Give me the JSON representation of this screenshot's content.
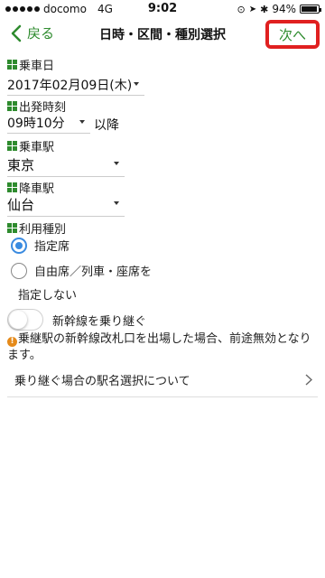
{
  "status_bar": {
    "carrier": "docomo",
    "network": "4G",
    "time": "9:02",
    "battery": "94%",
    "battery_level": 0.94
  },
  "nav": {
    "back_label": "戻る",
    "title": "日時・区間・種別選択",
    "next_label": "次へ"
  },
  "form": {
    "boarding_date": {
      "label": "乗車日",
      "value": "2017年02月09日(木)"
    },
    "departure_time": {
      "label": "出発時刻",
      "value": "09時10分",
      "suffix": "以降"
    },
    "boarding_station": {
      "label": "乗車駅",
      "value": "東京"
    },
    "arrival_station": {
      "label": "降車駅",
      "value": "仙台"
    },
    "seat_type": {
      "label": "利用種別",
      "options": [
        {
          "label": "指定席",
          "checked": true
        },
        {
          "label": "自由席／列車・座席を",
          "label2": "指定しない",
          "checked": false
        }
      ]
    },
    "transfer_toggle": {
      "label": "新幹線を乗り継ぐ",
      "on": false
    },
    "warning": "乗継駅の新幹線改札口を出場した場合、前途無効となります。",
    "warning_icon": "exclamation-icon",
    "info_link": "乗り継ぐ場合の駅名選択について"
  },
  "colors": {
    "accent": "#2e8b2e",
    "highlight": "#e02020",
    "radio": "#3a8be0",
    "warning": "#e58a1a"
  }
}
